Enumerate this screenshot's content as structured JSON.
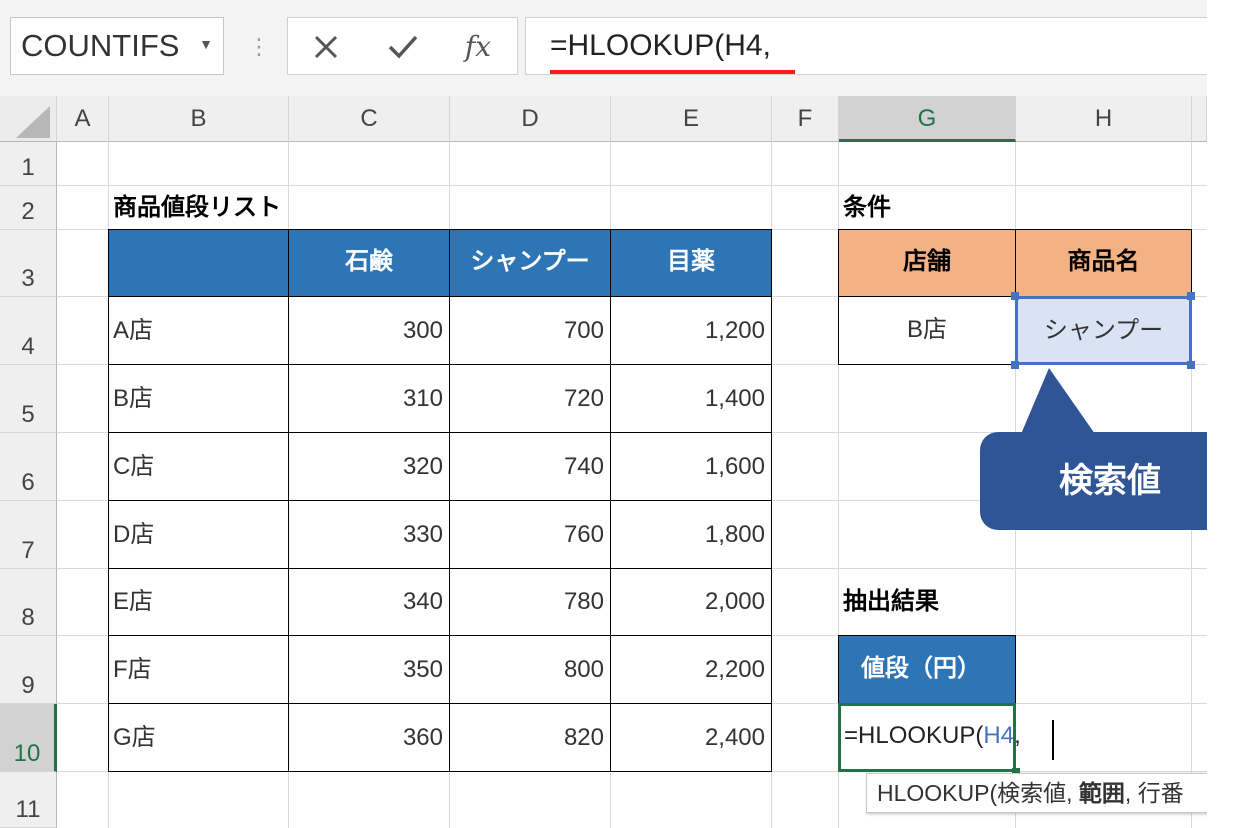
{
  "formula_bar": {
    "name_box": "COUNTIFS",
    "cancel_icon": "close-icon",
    "enter_icon": "check-icon",
    "fx_label": "fx",
    "formula": "=HLOOKUP(H4,"
  },
  "columns": [
    "A",
    "B",
    "C",
    "D",
    "E",
    "F",
    "G",
    "H"
  ],
  "rows": [
    "1",
    "2",
    "3",
    "4",
    "5",
    "6",
    "7",
    "8",
    "9",
    "10",
    "11"
  ],
  "price_list": {
    "title": "商品値段リスト",
    "headers": [
      "",
      "石鹸",
      "シャンプー",
      "目薬"
    ],
    "rows": [
      [
        "A店",
        "300",
        "700",
        "1,200"
      ],
      [
        "B店",
        "310",
        "720",
        "1,400"
      ],
      [
        "C店",
        "320",
        "740",
        "1,600"
      ],
      [
        "D店",
        "330",
        "760",
        "1,800"
      ],
      [
        "E店",
        "340",
        "780",
        "2,000"
      ],
      [
        "F店",
        "350",
        "800",
        "2,200"
      ],
      [
        "G店",
        "360",
        "820",
        "2,400"
      ]
    ]
  },
  "conditions": {
    "title": "条件",
    "headers": [
      "店舗",
      "商品名"
    ],
    "values": [
      "B店",
      "シャンプー"
    ]
  },
  "callout": {
    "label": "検索値"
  },
  "result": {
    "title": "抽出結果",
    "header": "値段（円）",
    "editing_prefix": "=HLOOKUP(",
    "editing_ref": "H4",
    "editing_suffix": ","
  },
  "tooltip": {
    "func": "HLOOKUP(",
    "arg1": "検索値, ",
    "arg2": "範囲",
    "arg3": ", 行番"
  },
  "colors": {
    "header_blue": "#2e75b6",
    "header_orange": "#f4b183",
    "callout_navy": "#2f5597",
    "selection_green": "#217346",
    "underline_red": "#ff1a1a",
    "reference_blue": "#4472c4"
  }
}
